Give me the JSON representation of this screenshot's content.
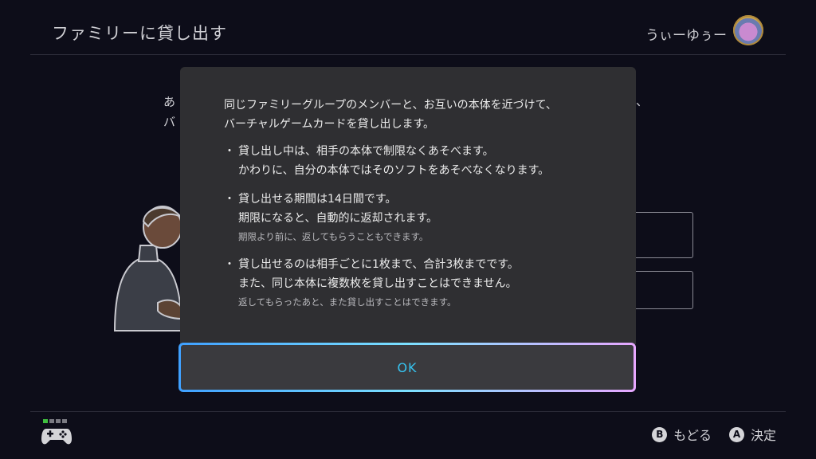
{
  "header": {
    "title": "ファミリーに貸し出す",
    "user_name": "うぃーゆぅー"
  },
  "background": {
    "line1": "あ",
    "line2": "バ",
    "right_fragment": "、"
  },
  "dialog": {
    "intro": [
      "同じファミリーグループのメンバーと、お互いの本体を近づけて、",
      "バーチャルゲームカードを貸し出します。"
    ],
    "bullets": [
      {
        "lines": [
          "貸し出し中は、相手の本体で制限なくあそべます。",
          "かわりに、自分の本体ではそのソフトをあそべなくなります。"
        ],
        "note": ""
      },
      {
        "lines": [
          "貸し出せる期間は14日間です。",
          "期限になると、自動的に返却されます。"
        ],
        "note": "期限より前に、返してもらうこともできます。"
      },
      {
        "lines": [
          "貸し出せるのは相手ごとに1枚まで、合計3枚までです。",
          "また、同じ本体に複数枚を貸し出すことはできません。"
        ],
        "note": "返してもらったあと、また貸し出すことはできます。"
      }
    ],
    "bullet_mark": "・",
    "ok_label": "OK"
  },
  "footer": {
    "back": {
      "glyph": "B",
      "label": "もどる"
    },
    "confirm": {
      "glyph": "A",
      "label": "決定"
    }
  },
  "colors": {
    "ok_text": "#36c3f0",
    "modal_bg": "#2f2f32",
    "screen_bg": "#0d0d19"
  },
  "icons": [
    "controller-icon",
    "avatar"
  ]
}
